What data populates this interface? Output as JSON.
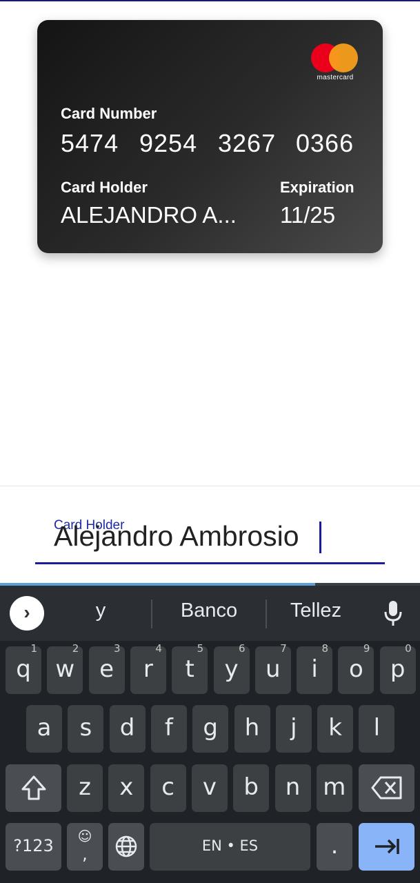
{
  "card": {
    "brand": "mastercard",
    "number_label": "Card Number",
    "number_groups": [
      "5474",
      "9254",
      "3267",
      "0366"
    ],
    "holder_label": "Card Holder",
    "holder_value": "ALEJANDRO A...",
    "expiration_label": "Expiration",
    "expiration_value": "11/25"
  },
  "form": {
    "field_label": "Card Holder",
    "field_value": "Alejandro Ambrosio"
  },
  "keyboard": {
    "suggestions": [
      "y",
      "Banco",
      "Tellez"
    ],
    "row1": [
      {
        "key": "q",
        "hint": "1"
      },
      {
        "key": "w",
        "hint": "2"
      },
      {
        "key": "e",
        "hint": "3"
      },
      {
        "key": "r",
        "hint": "4"
      },
      {
        "key": "t",
        "hint": "5"
      },
      {
        "key": "y",
        "hint": "6"
      },
      {
        "key": "u",
        "hint": "7"
      },
      {
        "key": "i",
        "hint": "8"
      },
      {
        "key": "o",
        "hint": "9"
      },
      {
        "key": "p",
        "hint": "0"
      }
    ],
    "row2": [
      "a",
      "s",
      "d",
      "f",
      "g",
      "h",
      "j",
      "k",
      "l"
    ],
    "row3": [
      "z",
      "x",
      "c",
      "v",
      "b",
      "n",
      "m"
    ],
    "symbols_key": "?123",
    "emoji_key": "☺",
    "comma_key": ",",
    "space_label": "EN • ES",
    "period_key": ".",
    "colors": {
      "accent": "#8ab4f8",
      "background": "#1f2327",
      "key": "#3c4043"
    }
  }
}
